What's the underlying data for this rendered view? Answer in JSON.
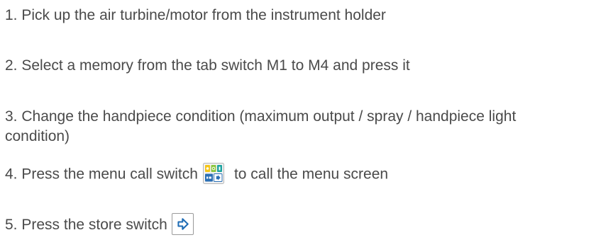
{
  "steps": [
    {
      "text": "1. Pick up the air turbine/motor from the instrument holder"
    },
    {
      "text": "2. Select a memory from the tab switch M1 to M4 and press it"
    },
    {
      "text": "3. Change the handpiece condition (maximum output / spray / handpiece light condition)"
    },
    {
      "before": "4. Press the menu call switch",
      "after": "to call the menu screen",
      "icon": "menu-call-icon"
    },
    {
      "before": "5. Press the store switch",
      "icon": "store-switch-icon"
    }
  ]
}
